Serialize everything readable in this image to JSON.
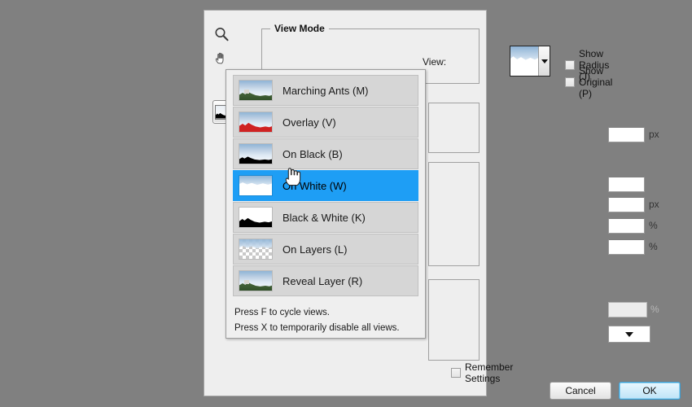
{
  "dialog": {
    "tools": [
      {
        "name": "zoom-tool",
        "icon": "magnifier-icon"
      },
      {
        "name": "hand-tool",
        "icon": "hand-icon"
      },
      {
        "name": "preview-toggle",
        "icon": "image-preview-icon"
      }
    ],
    "view_mode": {
      "group_title": "View Mode",
      "view_label": "View:",
      "selected_view": "On White (W)",
      "checkboxes": [
        {
          "label": "Show Radius (J)",
          "checked": false
        },
        {
          "label": "Show Original (P)",
          "checked": false
        }
      ]
    },
    "side_fields": [
      {
        "value": "",
        "unit": "px"
      },
      {
        "value": "",
        "unit": ""
      },
      {
        "value": "",
        "unit": "px"
      },
      {
        "value": "",
        "unit": "%"
      },
      {
        "value": "",
        "unit": "%"
      },
      {
        "value": "",
        "unit": "%"
      }
    ],
    "footer": {
      "remember_label": "Remember Settings",
      "remember_checked": false,
      "cancel_label": "Cancel",
      "ok_label": "OK"
    }
  },
  "dropdown": {
    "open": true,
    "highlight_color": "#1e9ef5",
    "items": [
      {
        "label": "Marching Ants (M)",
        "thumb": "marching-ants",
        "selected": false
      },
      {
        "label": "Overlay (V)",
        "thumb": "overlay-red",
        "selected": false
      },
      {
        "label": "On Black (B)",
        "thumb": "on-black",
        "selected": false
      },
      {
        "label": "On White (W)",
        "thumb": "on-white",
        "selected": true
      },
      {
        "label": "Black & White (K)",
        "thumb": "black-white",
        "selected": false
      },
      {
        "label": "On Layers (L)",
        "thumb": "on-layers",
        "selected": false
      },
      {
        "label": "Reveal Layer (R)",
        "thumb": "reveal-layer",
        "selected": false
      }
    ],
    "hints": [
      "Press F to cycle views.",
      "Press X to temporarily disable all views."
    ]
  }
}
